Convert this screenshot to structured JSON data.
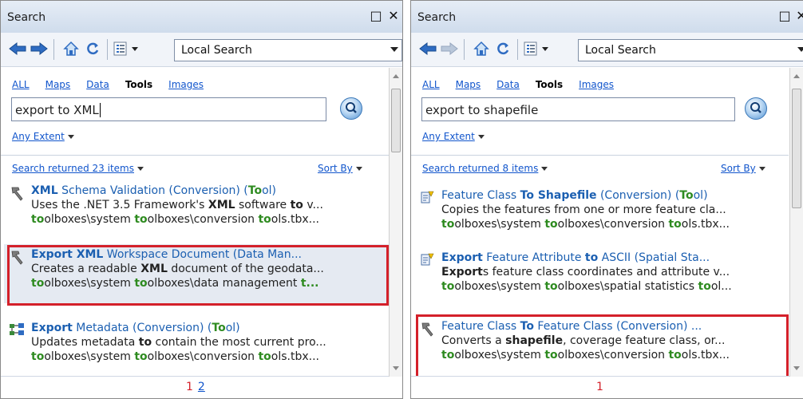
{
  "left": {
    "title": "Search",
    "dropdown": "Local Search",
    "tabs": [
      "ALL",
      "Maps",
      "Data",
      "Tools",
      "Images"
    ],
    "search_value": "export to XML",
    "extent": "Any Extent",
    "results": "Search returned 23 items",
    "sort": "Sort By",
    "pages": {
      "current": "1",
      "other": "2"
    },
    "items": [
      {
        "l1": [
          "XML",
          " Schema Validation (Conversion) (",
          "To",
          "ol)"
        ],
        "l2": [
          "Uses the .NET 3.5 Framework's ",
          "XML",
          " software ",
          "to",
          " v..."
        ],
        "l3": [
          "to",
          "olboxes\\system ",
          "to",
          "olboxes\\conversion ",
          "to",
          "ols.tbx..."
        ]
      },
      {
        "l1": [
          "Export XML",
          " Workspace Document (Data Man..."
        ],
        "l2": [
          "Creates a readable ",
          "XML",
          " document of the geodata..."
        ],
        "l3": [
          "to",
          "olboxes\\system ",
          "to",
          "olboxes\\data management ",
          "t..."
        ]
      },
      {
        "l1": [
          "Export",
          " Metadata (Conversion) (",
          "To",
          "ol)"
        ],
        "l2": [
          "Updates metadata ",
          "to",
          " contain the most current pro..."
        ],
        "l3": [
          "to",
          "olboxes\\system ",
          "to",
          "olboxes\\conversion ",
          "to",
          "ols.tbx..."
        ]
      }
    ]
  },
  "right": {
    "title": "Search",
    "dropdown": "Local Search",
    "tabs": [
      "ALL",
      "Maps",
      "Data",
      "Tools",
      "Images"
    ],
    "search_value": "export to shapefile",
    "extent": "Any Extent",
    "results": "Search returned 8 items",
    "sort": "Sort By",
    "pages": {
      "current": "1"
    },
    "items": [
      {
        "l1": [
          "Feature Class ",
          "To Shapefile",
          " (Conversion) (",
          "To",
          "ol)"
        ],
        "l2": [
          "Copies the features from one or more feature cla..."
        ],
        "l3": [
          "to",
          "olboxes\\system ",
          "to",
          "olboxes\\conversion ",
          "to",
          "ols.tbx..."
        ]
      },
      {
        "l1": [
          "Export",
          " Feature Attribute ",
          "to",
          " ASCII (Spatial Sta..."
        ],
        "l2": [
          "Export",
          "s feature class coordinates and attribute v..."
        ],
        "l3": [
          "to",
          "olboxes\\system ",
          "to",
          "olboxes\\spatial statistics ",
          "to",
          "ol..."
        ]
      },
      {
        "l1": [
          "Feature Class ",
          "To",
          " Feature Class (Conversion) ..."
        ],
        "l2": [
          "Converts a ",
          "shapefile",
          ", coverage feature class, or..."
        ],
        "l3": [
          "to",
          "olboxes\\system ",
          "to",
          "olboxes\\conversion ",
          "to",
          "ols.tbx..."
        ]
      }
    ]
  },
  "colors": {
    "accent_link": "#1155cc",
    "highlight_box": "#d4202a",
    "match_green": "#2e8b20"
  }
}
